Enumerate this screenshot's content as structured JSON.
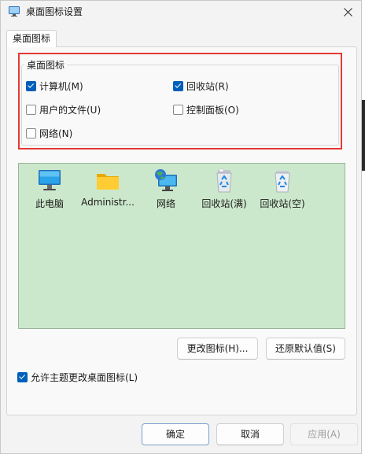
{
  "window": {
    "title": "桌面图标设置"
  },
  "tab": {
    "label": "桌面图标"
  },
  "group": {
    "legend": "桌面图标",
    "checkboxes": [
      {
        "label": "计算机(M)",
        "checked": true
      },
      {
        "label": "回收站(R)",
        "checked": true
      },
      {
        "label": "用户的文件(U)",
        "checked": false
      },
      {
        "label": "控制面板(O)",
        "checked": false
      },
      {
        "label": "网络(N)",
        "checked": false
      }
    ]
  },
  "icons": [
    {
      "label": "此电脑",
      "icon": "monitor-icon"
    },
    {
      "label": "Administr...",
      "icon": "folder-icon"
    },
    {
      "label": "网络",
      "icon": "network-globe-icon"
    },
    {
      "label": "回收站(满)",
      "icon": "recycle-bin-full-icon"
    },
    {
      "label": "回收站(空)",
      "icon": "recycle-bin-empty-icon"
    }
  ],
  "buttons": {
    "change_icon": "更改图标(H)...",
    "restore_default": "还原默认值(S)",
    "ok": "确定",
    "cancel": "取消",
    "apply": "应用(A)"
  },
  "theme_option": {
    "label": "允许主题更改桌面图标(L)",
    "checked": true
  },
  "colors": {
    "accent": "#005fb8",
    "icon_view_bg": "#cce8cc",
    "highlight_frame": "#e53935"
  }
}
